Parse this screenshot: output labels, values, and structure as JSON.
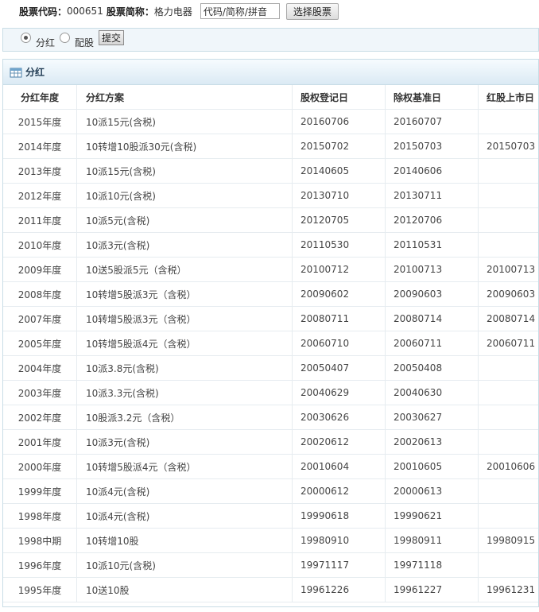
{
  "header": {
    "code_label": "股票代码：",
    "code_value": "000651",
    "name_label": "股票简称：",
    "name_value": "格力电器",
    "search_value": "代码/简称/拼音",
    "select_button": "选择股票"
  },
  "options": {
    "radio_dividend": "分红",
    "radio_rights": "配股",
    "selected": "分红",
    "submit": "提交"
  },
  "panel": {
    "title": "分红",
    "icon": "grid-icon",
    "columns": [
      "分红年度",
      "分红方案",
      "股权登记日",
      "除权基准日",
      "红股上市日"
    ],
    "rows": [
      [
        "2015年度",
        "10派15元(含税)",
        "20160706",
        "20160707",
        ""
      ],
      [
        "2014年度",
        "10转增10股派30元(含税)",
        "20150702",
        "20150703",
        "20150703"
      ],
      [
        "2013年度",
        "10派15元(含税)",
        "20140605",
        "20140606",
        ""
      ],
      [
        "2012年度",
        "10派10元(含税)",
        "20130710",
        "20130711",
        ""
      ],
      [
        "2011年度",
        "10派5元(含税)",
        "20120705",
        "20120706",
        ""
      ],
      [
        "2010年度",
        "10派3元(含税)",
        "20110530",
        "20110531",
        ""
      ],
      [
        "2009年度",
        "10送5股派5元（含税）",
        "20100712",
        "20100713",
        "20100713"
      ],
      [
        "2008年度",
        "10转增5股派3元（含税）",
        "20090602",
        "20090603",
        "20090603"
      ],
      [
        "2007年度",
        "10转增5股派3元（含税）",
        "20080711",
        "20080714",
        "20080714"
      ],
      [
        "2005年度",
        "10转增5股派4元（含税）",
        "20060710",
        "20060711",
        "20060711"
      ],
      [
        "2004年度",
        "10派3.8元(含税)",
        "20050407",
        "20050408",
        ""
      ],
      [
        "2003年度",
        "10派3.3元(含税)",
        "20040629",
        "20040630",
        ""
      ],
      [
        "2002年度",
        "10股派3.2元（含税）",
        "20030626",
        "20030627",
        ""
      ],
      [
        "2001年度",
        "10派3元(含税)",
        "20020612",
        "20020613",
        ""
      ],
      [
        "2000年度",
        "10转增5股派4元（含税）",
        "20010604",
        "20010605",
        "20010606"
      ],
      [
        "1999年度",
        "10派4元(含税)",
        "20000612",
        "20000613",
        ""
      ],
      [
        "1998年度",
        "10派4元(含税)",
        "19990618",
        "19990621",
        ""
      ],
      [
        "1998中期",
        "10转增10股",
        "19980910",
        "19980911",
        "19980915"
      ],
      [
        "1996年度",
        "10派10元(含税)",
        "19971117",
        "19971118",
        ""
      ],
      [
        "1995年度",
        "10送10股",
        "19961226",
        "19961227",
        "19961231"
      ]
    ]
  },
  "colors": {
    "panel_border": "#c9dde6",
    "header_gradient_bottom": "#dbeaf4",
    "title_text": "#1f3a52"
  }
}
